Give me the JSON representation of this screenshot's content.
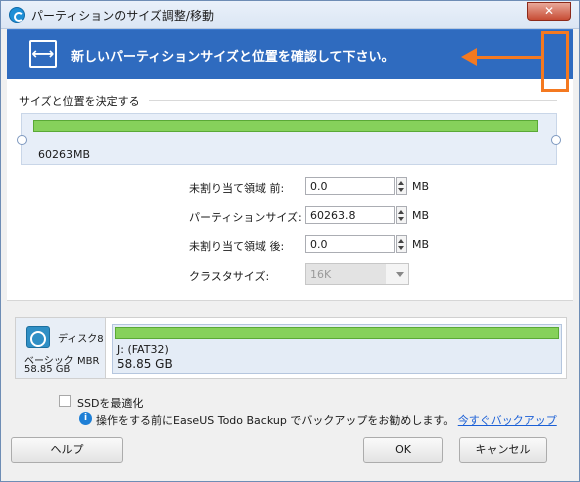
{
  "window": {
    "title": "パーティションのサイズ調整/移動",
    "close_label": "✕"
  },
  "header": {
    "icon_glyph": "⟷",
    "title": "新しいパーティションサイズと位置を確認して下さい。"
  },
  "resize_group": {
    "label": "サイズと位置を決定する",
    "partition_size_label": "60263MB"
  },
  "form": {
    "unallocated_before_label": "未割り当て領域 前:",
    "unallocated_before_value": "0.0",
    "partition_size_label": "パーティションサイズ:",
    "partition_size_value": "60263.8",
    "unallocated_after_label": "未割り当て領域 後:",
    "unallocated_after_value": "0.0",
    "cluster_size_label": "クラスタサイズ:",
    "cluster_size_value": "16K",
    "unit": "MB"
  },
  "disk": {
    "name": "ディスク8",
    "type": "ベーシック MBR",
    "size": "58.85 GB",
    "partition_label": "J: (FAT32)",
    "partition_size": "58.85 GB"
  },
  "options": {
    "ssd_optimize_label": "SSDを最適化",
    "info_text": "操作をする前にEaseUS Todo Backup でバックアップをお勧めします。",
    "info_link": "今すぐバックアップ"
  },
  "buttons": {
    "help": "ヘルプ",
    "ok": "OK",
    "cancel": "キャンセル"
  },
  "colors": {
    "header_bg": "#2f6bbf",
    "partition_fill": "#86d15b",
    "annotation": "#f47920"
  }
}
